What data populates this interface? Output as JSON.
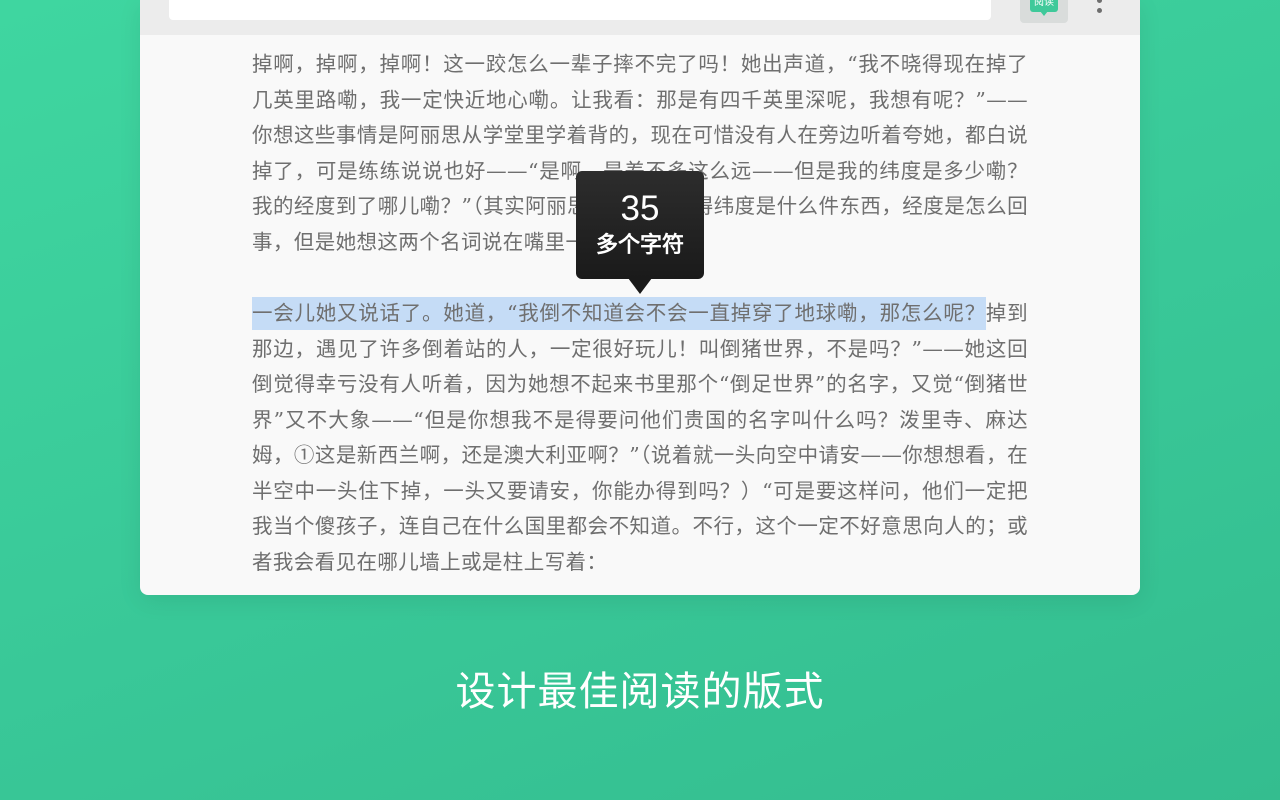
{
  "extension": {
    "badge_label": "阅读",
    "accent_color": "#3fc99a",
    "icon": "reader-badge-icon"
  },
  "toolbar": {
    "more_icon": "more-vertical-icon"
  },
  "article": {
    "paragraph1": "掉啊，掉啊，掉啊！这一跤怎么一辈子摔不完了吗！她出声道，“我不晓得现在掉了几英里路嘞，我一定快近地心嘞。让我看：那是有四千英里深呢，我想有呢？”——你想这些事情是阿丽思从学堂里学着背的，现在可惜没有人在旁边听着夸她，都白说掉了，可是练练说说也好——“是啊，是差不多这么远——但是我的纬度是多少嘞？我的经度到了哪儿嘞？”（其实阿丽思一点也不懂得纬度是什么件东西，经度是怎么回事，但是她想这两个名词说在嘴里一定很好听的。",
    "paragraph2_selected": "一会儿她又说话了。她道，“我倒不知道会不会一直掉穿了地球嘞，那怎么呢？",
    "paragraph2_rest": "掉到那边，遇见了许多倒着站的人，一定很好玩儿！叫倒猪世界，不是吗？”——她这回倒觉得幸亏没有人听着，因为她想不起来书里那个“倒足世界”的名字，又觉“倒猪世界”又不大象——“但是你想我不是得要问他们贵国的名字叫什么吗？泼里寺、麻达姆，①这是新西兰啊，还是澳大利亚啊？”（说着就一头向空中请安——你想想看，在半空中一头住下掉，一头又要请安，你能办得到吗？）“可是要这样问，他们一定把我当个傻孩子，连自己在什么国里都会不知道。不行，这个一定不好意思向人的；或者我会看见在哪儿墙上或是柱上写着："
  },
  "tooltip": {
    "count": "35",
    "label": "多个字符"
  },
  "tagline": "设计最佳阅读的版式",
  "colors": {
    "background": "#3ccf9c",
    "selection": "#c5dcf6",
    "tooltip_bg": "#222222",
    "text": "#6f6f6f"
  }
}
